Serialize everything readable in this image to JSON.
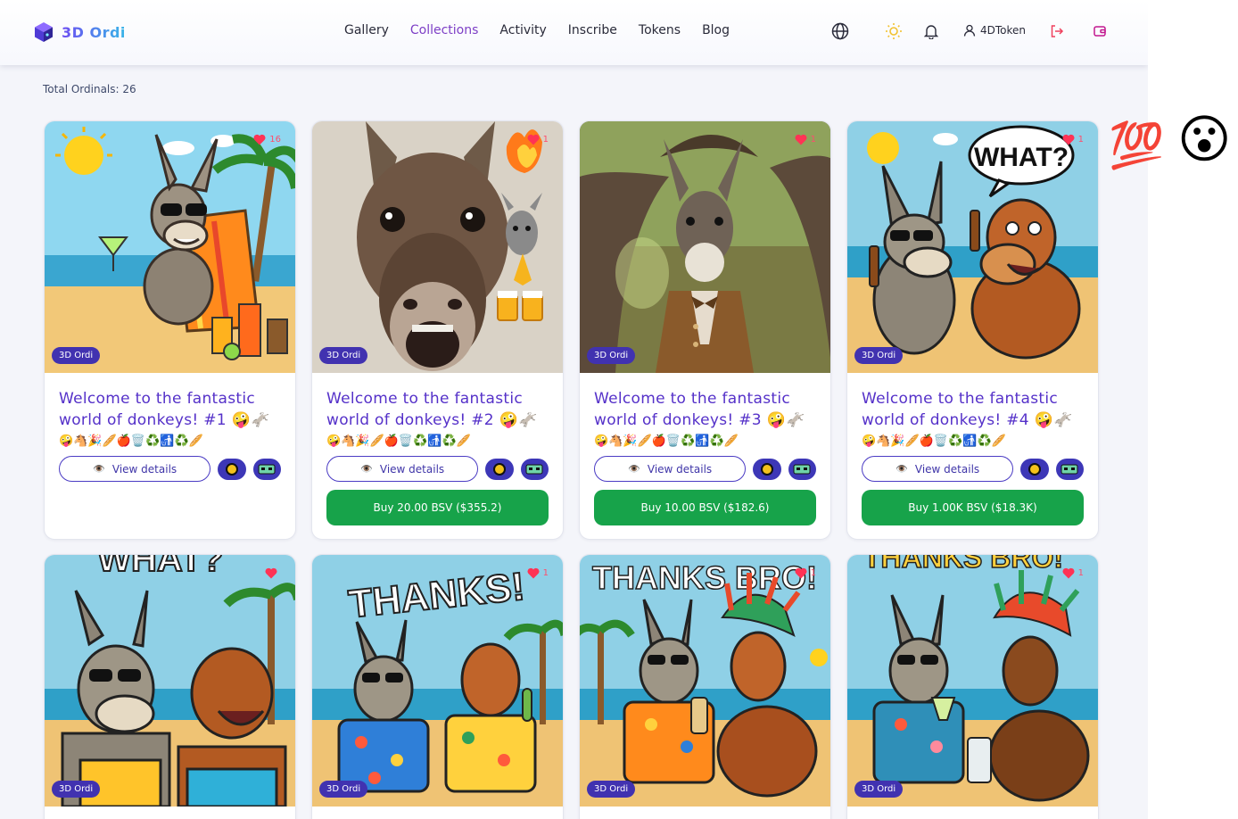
{
  "header": {
    "logo_text": "3D Ordi",
    "nav": [
      "Gallery",
      "Collections",
      "Activity",
      "Inscribe",
      "Tokens",
      "Blog"
    ],
    "active_nav": "Collections",
    "user_label": "4DToken",
    "accent_color": "#7d3fc6"
  },
  "summary": {
    "total_label": "Total Ordinals: 26"
  },
  "cards": [
    {
      "title": "Welcome to the fantastic world of donkeys! #1 🤪🫏",
      "emojis": "🤪🐴🎉🥖🍎🗑️♻️🚮♻️🥖",
      "badge": "3D Ordi",
      "likes": "16",
      "view_label": "View details",
      "buy_label": ""
    },
    {
      "title": "Welcome to the fantastic world of donkeys! #2 🤪🫏",
      "emojis": "🤪🐴🎉🥖🍎🗑️♻️🚮♻️🥖",
      "badge": "3D Ordi",
      "likes": "1",
      "view_label": "View details",
      "buy_label": "Buy 20.00 BSV ($355.2)"
    },
    {
      "title": "Welcome to the fantastic world of donkeys! #3 🤪🫏",
      "emojis": "🤪🐴🎉🥖🍎🗑️♻️🚮♻️🥖",
      "badge": "3D Ordi",
      "likes": "1",
      "view_label": "View details",
      "buy_label": "Buy 10.00 BSV ($182.6)"
    },
    {
      "title": "Welcome to the fantastic world of donkeys! #4 🤪🫏",
      "emojis": "🤪🐴🎉🥖🍎🗑️♻️🚮♻️🥖",
      "badge": "3D Ordi",
      "likes": "1",
      "view_label": "View details",
      "buy_label": "Buy 1.00K BSV ($18.3K)"
    },
    {
      "badge": "3D Ordi",
      "likes": ""
    },
    {
      "badge": "3D Ordi",
      "likes": "1"
    },
    {
      "badge": "3D Ordi",
      "likes": "1"
    },
    {
      "badge": "3D Ordi",
      "likes": "1"
    }
  ],
  "art_text": {
    "card4": "WHAT?",
    "card5": "WHAT?",
    "card6": "THANKS!",
    "card7": "THANKS BRO!",
    "card8": "THANKS BRO!"
  },
  "floaters": {
    "hundred": "💯",
    "shocked": "😮"
  },
  "colors": {
    "title": "#5531c9",
    "badge": "#4132b0",
    "buy": "#17a34a",
    "heart": "#ff4d6d"
  }
}
